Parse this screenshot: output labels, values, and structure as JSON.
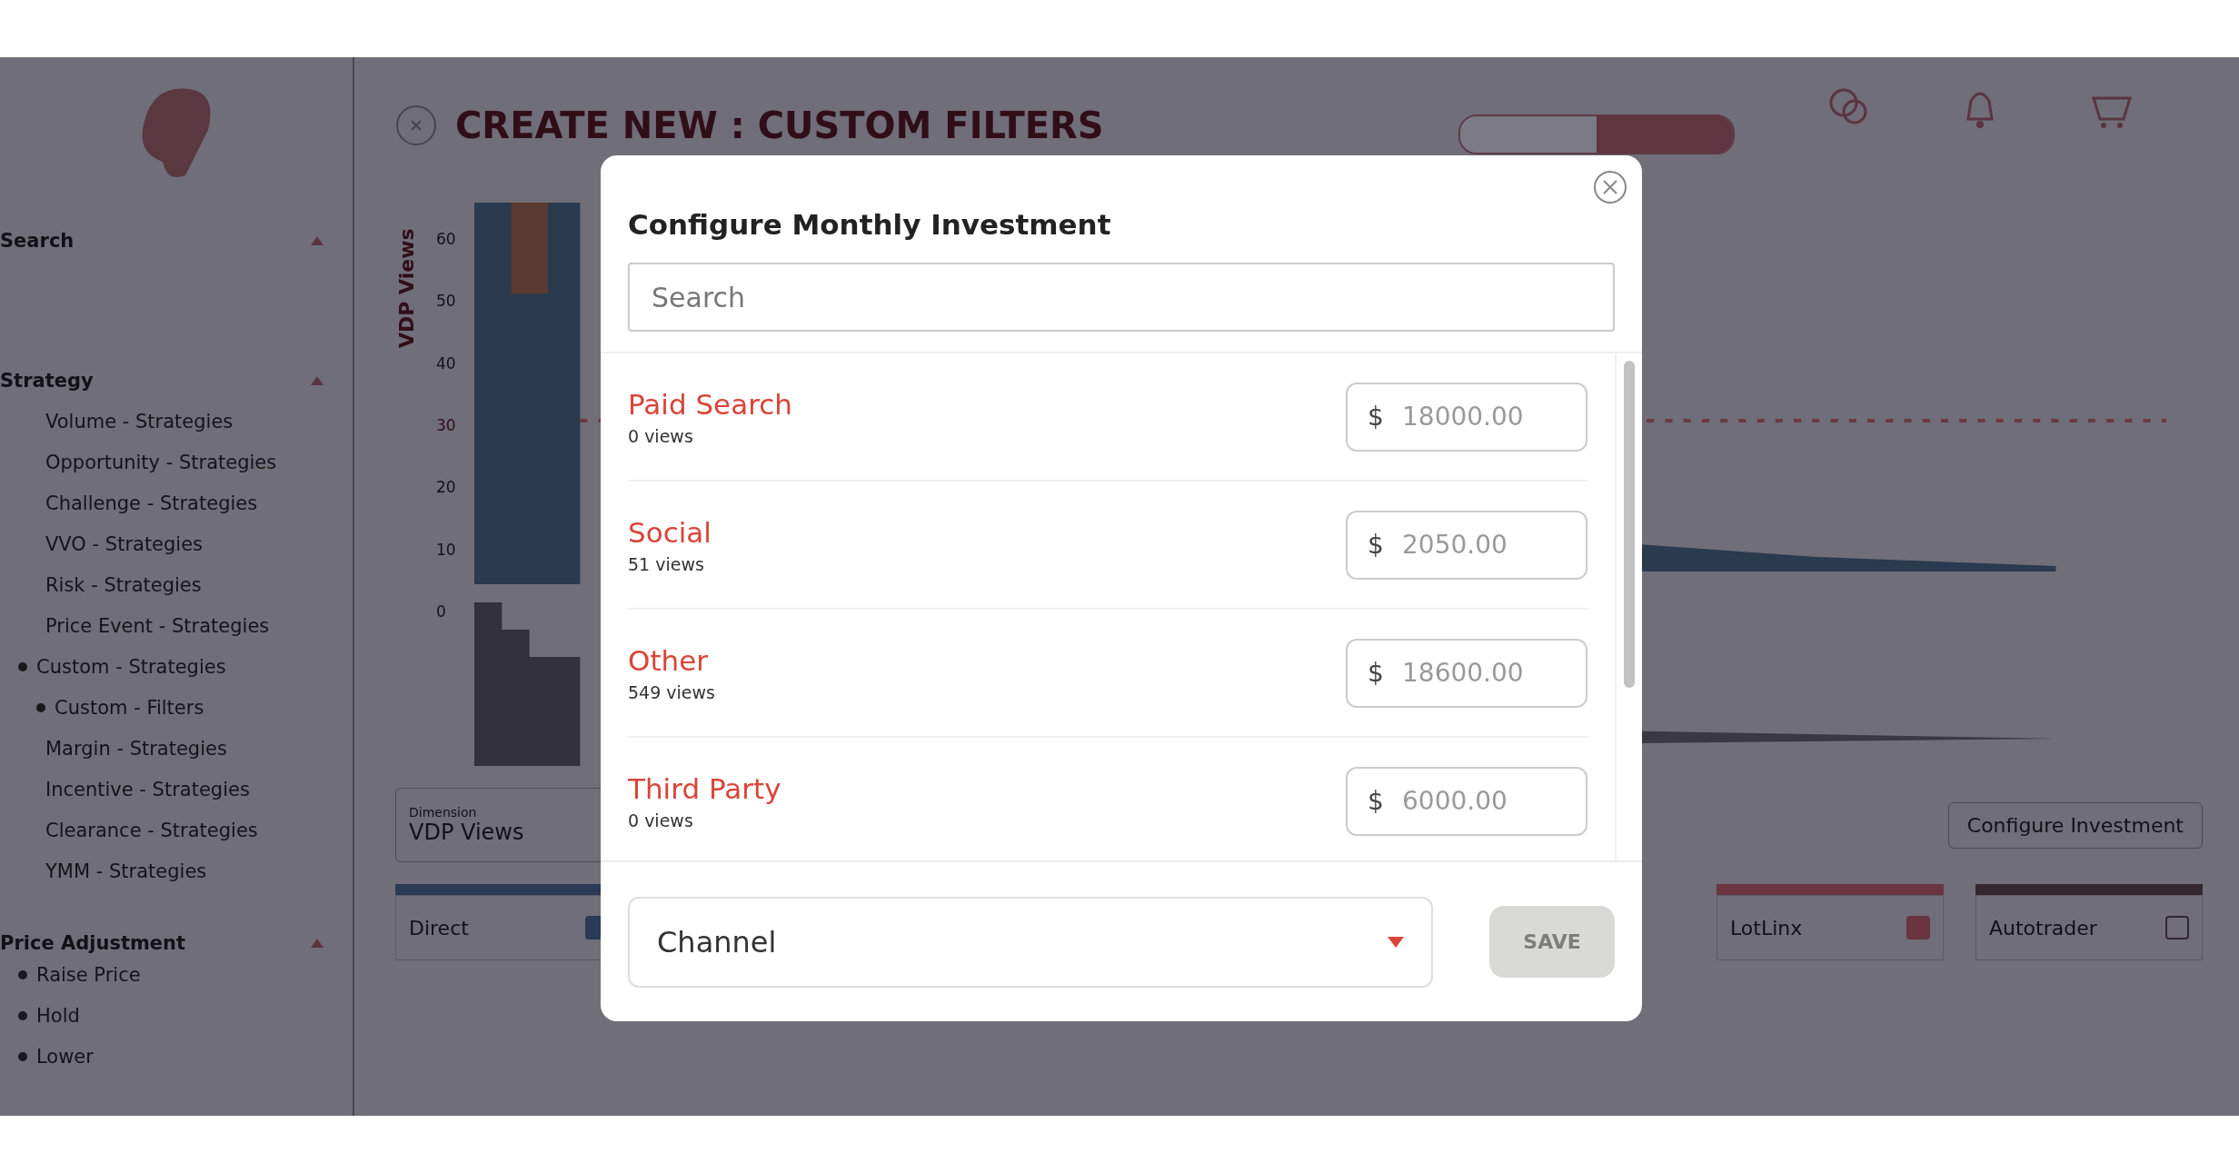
{
  "header": {
    "title": "CREATE NEW : CUSTOM FILTERS",
    "toggle_segments": [
      {
        "selected": false
      },
      {
        "selected": true
      }
    ]
  },
  "sidebar": {
    "search_heading": "Search",
    "strategy_heading": "Strategy",
    "strategies": [
      {
        "label": "Volume - Strategies"
      },
      {
        "label": "Opportunity - Strategies"
      },
      {
        "label": "Challenge - Strategies"
      },
      {
        "label": "VVO - Strategies"
      },
      {
        "label": "Risk - Strategies"
      },
      {
        "label": "Price Event - Strategies"
      },
      {
        "label": "Custom - Strategies",
        "children": [
          {
            "label": "Custom - Filters"
          }
        ]
      },
      {
        "label": "Margin - Strategies"
      },
      {
        "label": "Incentive - Strategies"
      },
      {
        "label": "Clearance - Strategies"
      },
      {
        "label": "YMM - Strategies"
      }
    ],
    "price_adjustment_heading": "Price Adjustment",
    "price_adjustments": [
      "Raise Price",
      "Hold",
      "Lower"
    ]
  },
  "chart": {
    "ylabel": "VDP Views",
    "yticks": [
      "60",
      "50",
      "40",
      "30",
      "20",
      "10",
      "0"
    ]
  },
  "dimension": {
    "label": "Dimension",
    "value": "VDP Views"
  },
  "configure_button": "Configure Investment",
  "channels": [
    {
      "name": "Direct",
      "color": "#2b3a55",
      "checked": true
    },
    {
      "name": "LotLinx",
      "color": "#6a3440",
      "checked": true
    },
    {
      "name": "Autotrader",
      "color": "#33282e",
      "checked": false
    }
  ],
  "modal": {
    "title": "Configure Monthly Investment",
    "search": {
      "placeholder": "Search"
    },
    "items": [
      {
        "name": "Paid Search",
        "views": "0 views",
        "currency": "$",
        "amount": "18000.00"
      },
      {
        "name": "Social",
        "views": "51 views",
        "currency": "$",
        "amount": "2050.00"
      },
      {
        "name": "Other",
        "views": "549 views",
        "currency": "$",
        "amount": "18600.00"
      },
      {
        "name": "Third Party",
        "views": "0 views",
        "currency": "$",
        "amount": "6000.00"
      }
    ],
    "channel_select": {
      "value": "Channel"
    },
    "save_button": {
      "label": "SAVE",
      "disabled": true
    }
  }
}
